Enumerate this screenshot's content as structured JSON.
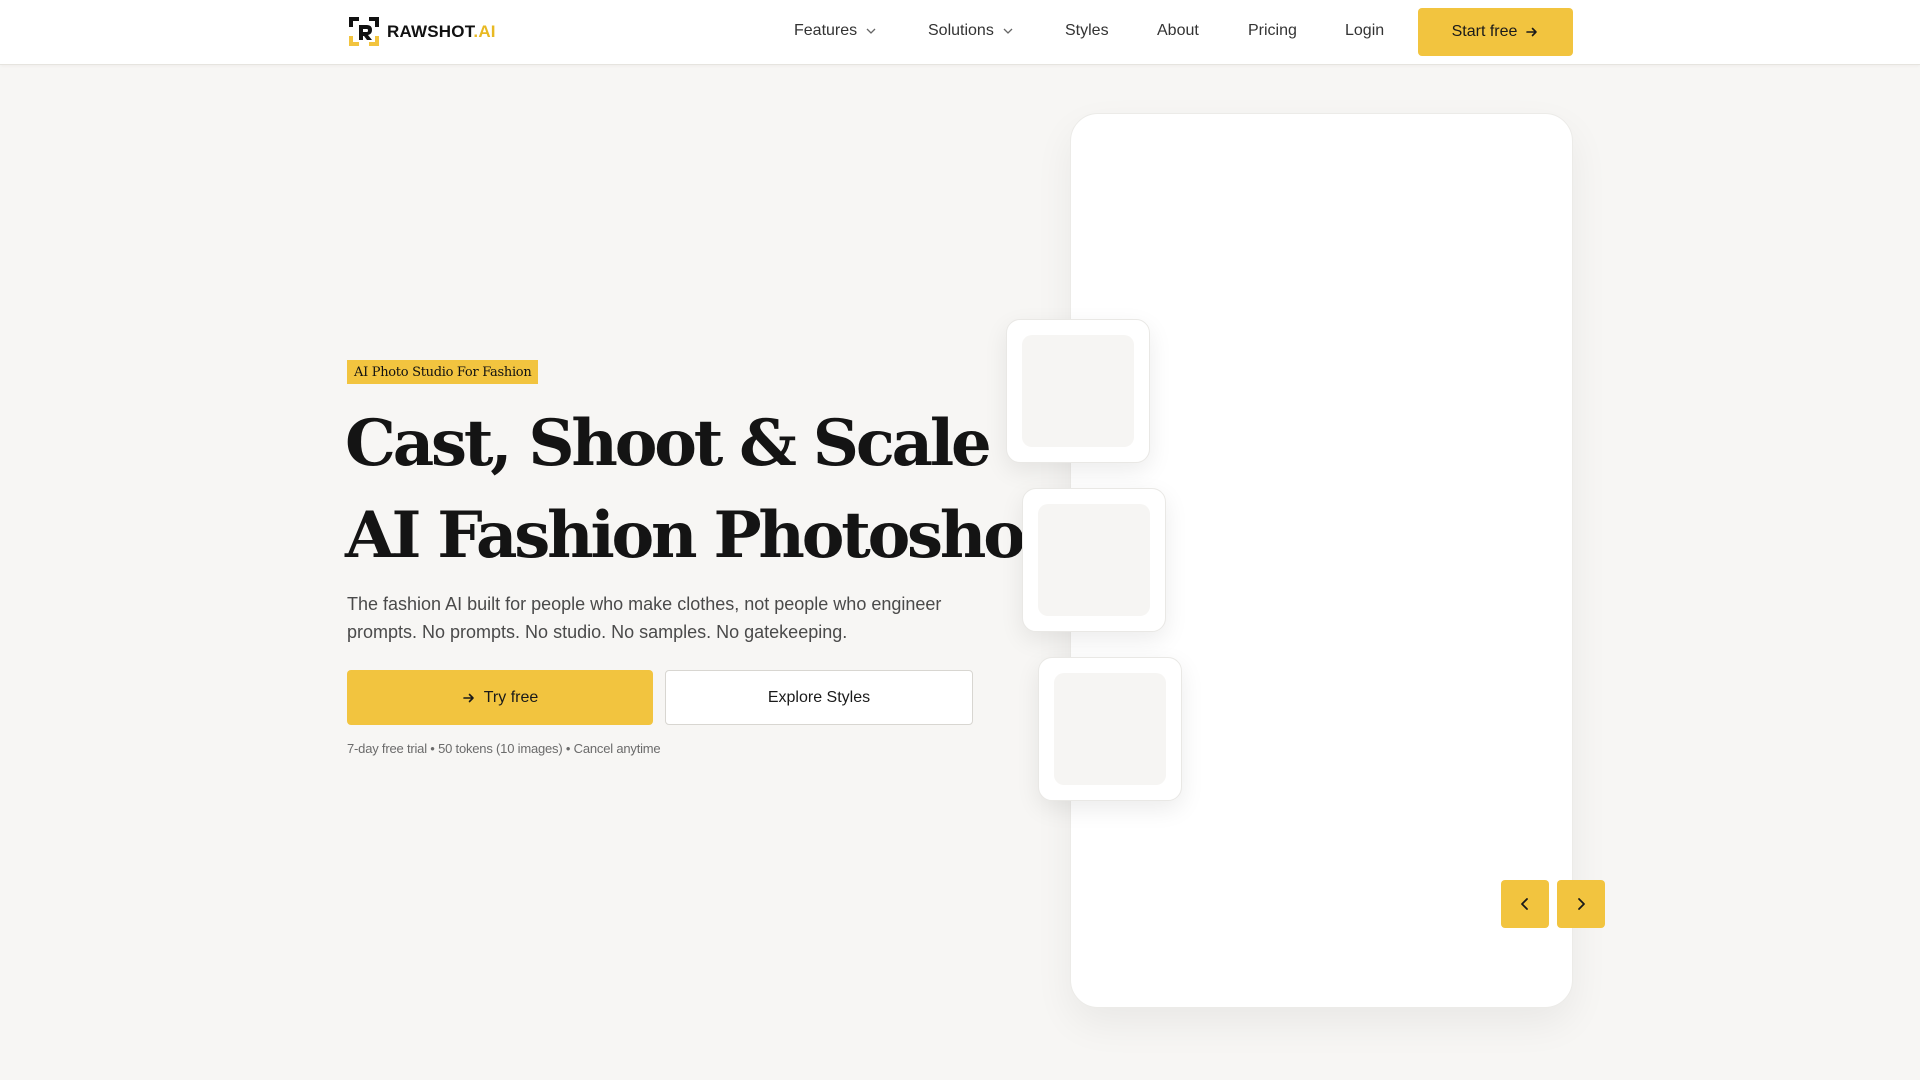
{
  "brand": {
    "name": "RAWSHOT",
    "suffix": ".AI",
    "accent": "#f2c43f"
  },
  "nav": {
    "items": [
      {
        "label": "Features",
        "dropdown": true
      },
      {
        "label": "Solutions",
        "dropdown": true
      },
      {
        "label": "Styles",
        "dropdown": false
      },
      {
        "label": "About",
        "dropdown": false
      },
      {
        "label": "Pricing",
        "dropdown": false
      },
      {
        "label": "Login",
        "dropdown": false
      }
    ],
    "cta": "Start free"
  },
  "hero": {
    "badge": "AI Photo Studio For Fashion",
    "headline_line1": "Cast, Shoot & Scale",
    "headline_line2": "AI Fashion Photoshoots",
    "subtext": "The fashion AI built for people who make clothes, not people who engineer prompts. No prompts. No studio. No samples. No gatekeeping.",
    "primary_cta": "Try free",
    "secondary_cta": "Explore Styles",
    "trial_note": "7-day free trial • 50 tokens (10 images) • Cancel anytime"
  },
  "carousel": {
    "prev_icon": "chevron-left-icon",
    "next_icon": "chevron-right-icon"
  }
}
